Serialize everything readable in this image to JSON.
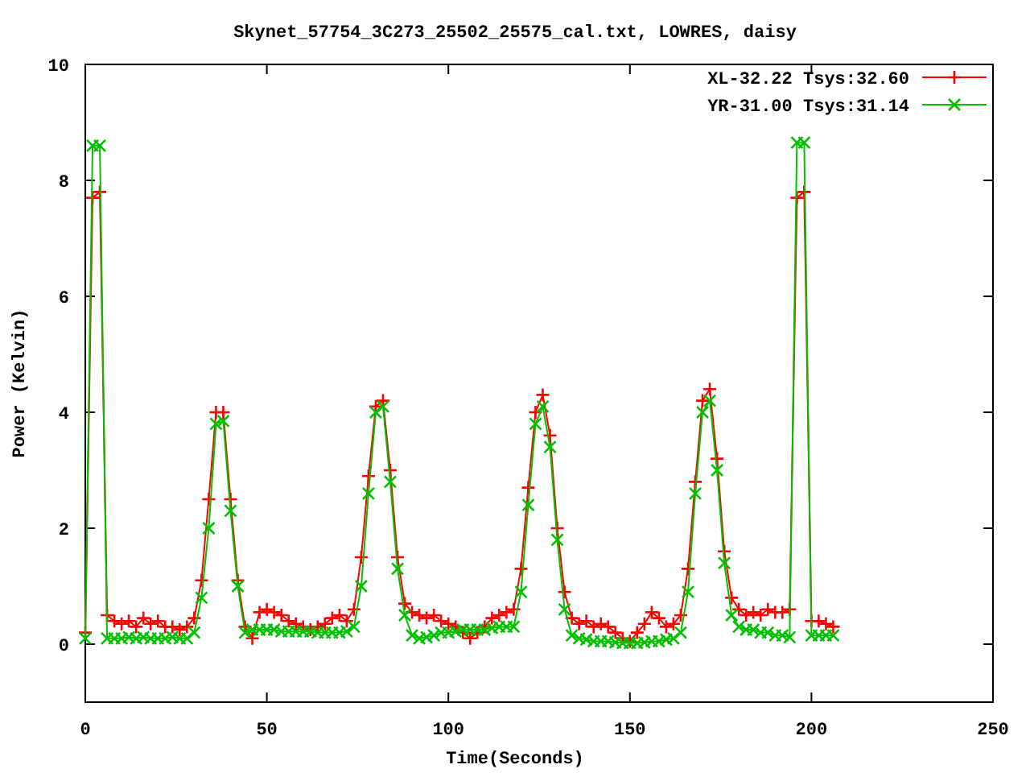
{
  "chart_data": {
    "type": "line",
    "title": "Skynet_57754_3C273_25502_25575_cal.txt, LOWRES, daisy",
    "xlabel": "Time(Seconds)",
    "ylabel": "Power (Kelvin)",
    "xlim": [
      0,
      250
    ],
    "ylim": [
      -1,
      10
    ],
    "xticks": [
      0,
      50,
      100,
      150,
      200,
      250
    ],
    "yticks": [
      0,
      2,
      4,
      6,
      8,
      10
    ],
    "legend": true,
    "x": [
      0,
      2,
      4,
      6,
      8,
      10,
      12,
      14,
      16,
      18,
      20,
      22,
      24,
      26,
      28,
      30,
      32,
      34,
      36,
      38,
      40,
      42,
      44,
      46,
      48,
      50,
      52,
      54,
      56,
      58,
      60,
      62,
      64,
      66,
      68,
      70,
      72,
      74,
      76,
      78,
      80,
      82,
      84,
      86,
      88,
      90,
      92,
      94,
      96,
      98,
      100,
      102,
      104,
      106,
      108,
      110,
      112,
      114,
      116,
      118,
      120,
      122,
      124,
      126,
      128,
      130,
      132,
      134,
      136,
      138,
      140,
      142,
      144,
      146,
      148,
      150,
      152,
      154,
      156,
      158,
      160,
      162,
      164,
      166,
      168,
      170,
      172,
      174,
      176,
      178,
      180,
      182,
      184,
      186,
      188,
      190,
      192,
      194,
      196,
      198,
      200,
      202,
      204,
      206
    ],
    "series": [
      {
        "name": "XL-32.22 Tsys:32.60",
        "color": "#ff0000",
        "marker": "plus",
        "values": [
          0.2,
          7.7,
          7.8,
          0.5,
          0.4,
          0.35,
          0.4,
          0.3,
          0.45,
          0.35,
          0.4,
          0.3,
          0.3,
          0.25,
          0.3,
          0.45,
          1.1,
          2.5,
          4.0,
          4.0,
          2.5,
          1.1,
          0.3,
          0.1,
          0.55,
          0.6,
          0.55,
          0.5,
          0.4,
          0.35,
          0.3,
          0.25,
          0.3,
          0.35,
          0.45,
          0.5,
          0.4,
          0.6,
          1.5,
          2.9,
          4.1,
          4.2,
          3.0,
          1.5,
          0.7,
          0.55,
          0.5,
          0.45,
          0.5,
          0.4,
          0.35,
          0.3,
          0.2,
          0.1,
          0.2,
          0.3,
          0.45,
          0.5,
          0.55,
          0.6,
          1.3,
          2.7,
          4.0,
          4.3,
          3.6,
          2.0,
          0.9,
          0.45,
          0.35,
          0.4,
          0.3,
          0.35,
          0.3,
          0.2,
          0.1,
          0.05,
          0.2,
          0.35,
          0.55,
          0.45,
          0.3,
          0.35,
          0.5,
          1.3,
          2.8,
          4.2,
          4.4,
          3.2,
          1.6,
          0.8,
          0.6,
          0.5,
          0.55,
          0.5,
          0.6,
          0.55,
          0.55,
          0.6,
          7.7,
          7.8,
          0.4,
          0.4,
          0.35,
          0.3
        ]
      },
      {
        "name": "YR-31.00 Tsys:31.14",
        "color": "#00c000",
        "marker": "cross",
        "values": [
          0.1,
          8.6,
          8.6,
          0.1,
          0.1,
          0.1,
          0.12,
          0.1,
          0.12,
          0.1,
          0.1,
          0.1,
          0.12,
          0.1,
          0.1,
          0.2,
          0.8,
          2.0,
          3.8,
          3.85,
          2.3,
          1.0,
          0.2,
          0.25,
          0.25,
          0.25,
          0.25,
          0.22,
          0.22,
          0.22,
          0.22,
          0.22,
          0.2,
          0.2,
          0.2,
          0.2,
          0.22,
          0.3,
          1.0,
          2.6,
          4.0,
          4.1,
          2.8,
          1.3,
          0.5,
          0.15,
          0.1,
          0.12,
          0.15,
          0.2,
          0.2,
          0.22,
          0.25,
          0.25,
          0.25,
          0.25,
          0.28,
          0.3,
          0.3,
          0.3,
          0.9,
          2.4,
          3.8,
          4.1,
          3.4,
          1.8,
          0.6,
          0.15,
          0.1,
          0.08,
          0.05,
          0.05,
          0.05,
          0.03,
          0.02,
          0.02,
          0.02,
          0.03,
          0.05,
          0.05,
          0.08,
          0.1,
          0.2,
          0.9,
          2.6,
          4.0,
          4.2,
          3.0,
          1.4,
          0.5,
          0.3,
          0.25,
          0.25,
          0.2,
          0.2,
          0.15,
          0.15,
          0.12,
          8.65,
          8.65,
          0.15,
          0.15,
          0.15,
          0.15
        ]
      }
    ]
  }
}
